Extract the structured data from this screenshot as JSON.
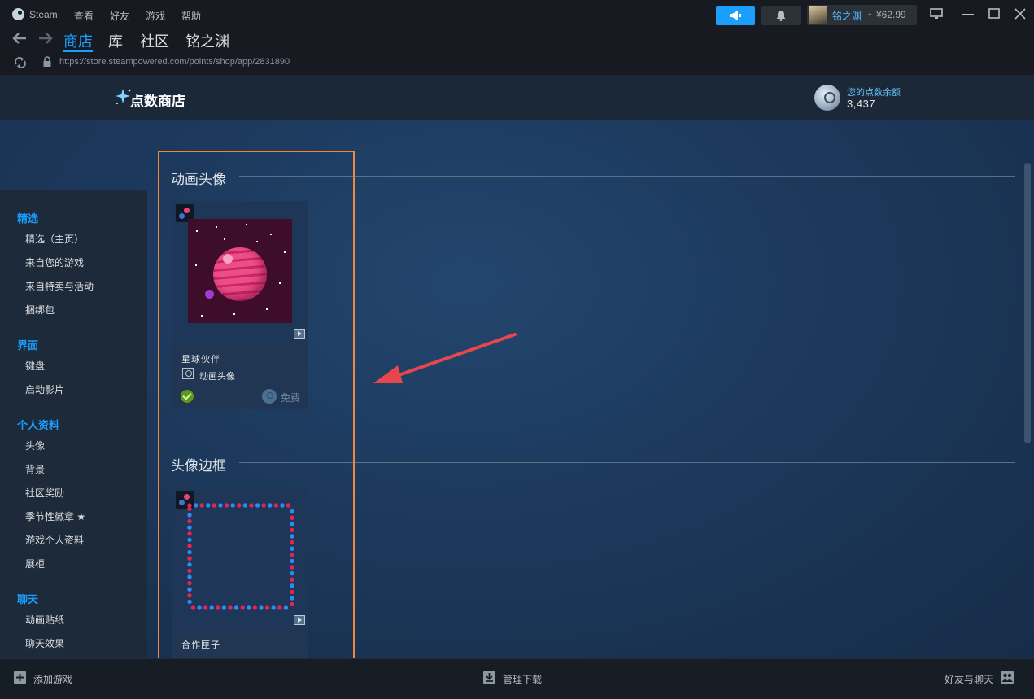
{
  "titlebar": {
    "app_name": "Steam",
    "menus": [
      "查看",
      "好友",
      "游戏",
      "帮助"
    ],
    "account_name": "铭之渊",
    "account_caret": "⌄",
    "account_balance": "¥62.99"
  },
  "nav": {
    "tabs": [
      "商店",
      "库",
      "社区",
      "铭之渊"
    ],
    "active_tab": "商店",
    "url": "https://store.steampowered.com/points/shop/app/2831890"
  },
  "points": {
    "title": "点数商店",
    "balance_label": "您的点数余额",
    "balance_value": "3,437"
  },
  "sidebar": {
    "groups": [
      {
        "heading": "精选",
        "items": [
          "精选（主页）",
          "来自您的游戏",
          "来自特卖与活动",
          "捆绑包"
        ]
      },
      {
        "heading": "界面",
        "items": [
          "键盘",
          "启动影片"
        ]
      },
      {
        "heading": "个人资料",
        "items": [
          "头像",
          "背景",
          "社区奖励",
          "季节性徽章 ★",
          "游戏个人资料",
          "展柜"
        ]
      },
      {
        "heading": "聊天",
        "items": [
          "动画贴纸",
          "聊天效果"
        ]
      }
    ]
  },
  "sections": {
    "animated_avatar": {
      "title": "动画头像",
      "card": {
        "name": "星球伙伴",
        "type": "动画头像",
        "price": "免费",
        "owned": true
      }
    },
    "avatar_frame": {
      "title": "头像边框",
      "card": {
        "name": "合作匣子"
      }
    }
  },
  "footer": {
    "add_game": "添加游戏",
    "manage_downloads": "管理下载",
    "friends_chat": "好友与聊天"
  },
  "colors": {
    "accent": "#1a9fff",
    "highlight_box": "#f0873a",
    "arrow": "#e8464d",
    "owned": "#5c9a1b"
  },
  "icons": [
    "steam-logo-icon",
    "megaphone-icon",
    "bell-icon",
    "monitor-icon",
    "minimize-icon",
    "maximize-icon",
    "close-icon",
    "back-arrow-icon",
    "forward-arrow-icon",
    "reload-icon",
    "lock-icon",
    "sparkle-icon",
    "points-coin-icon",
    "video-icon",
    "check-icon",
    "add-icon",
    "download-icon",
    "friends-icon"
  ]
}
